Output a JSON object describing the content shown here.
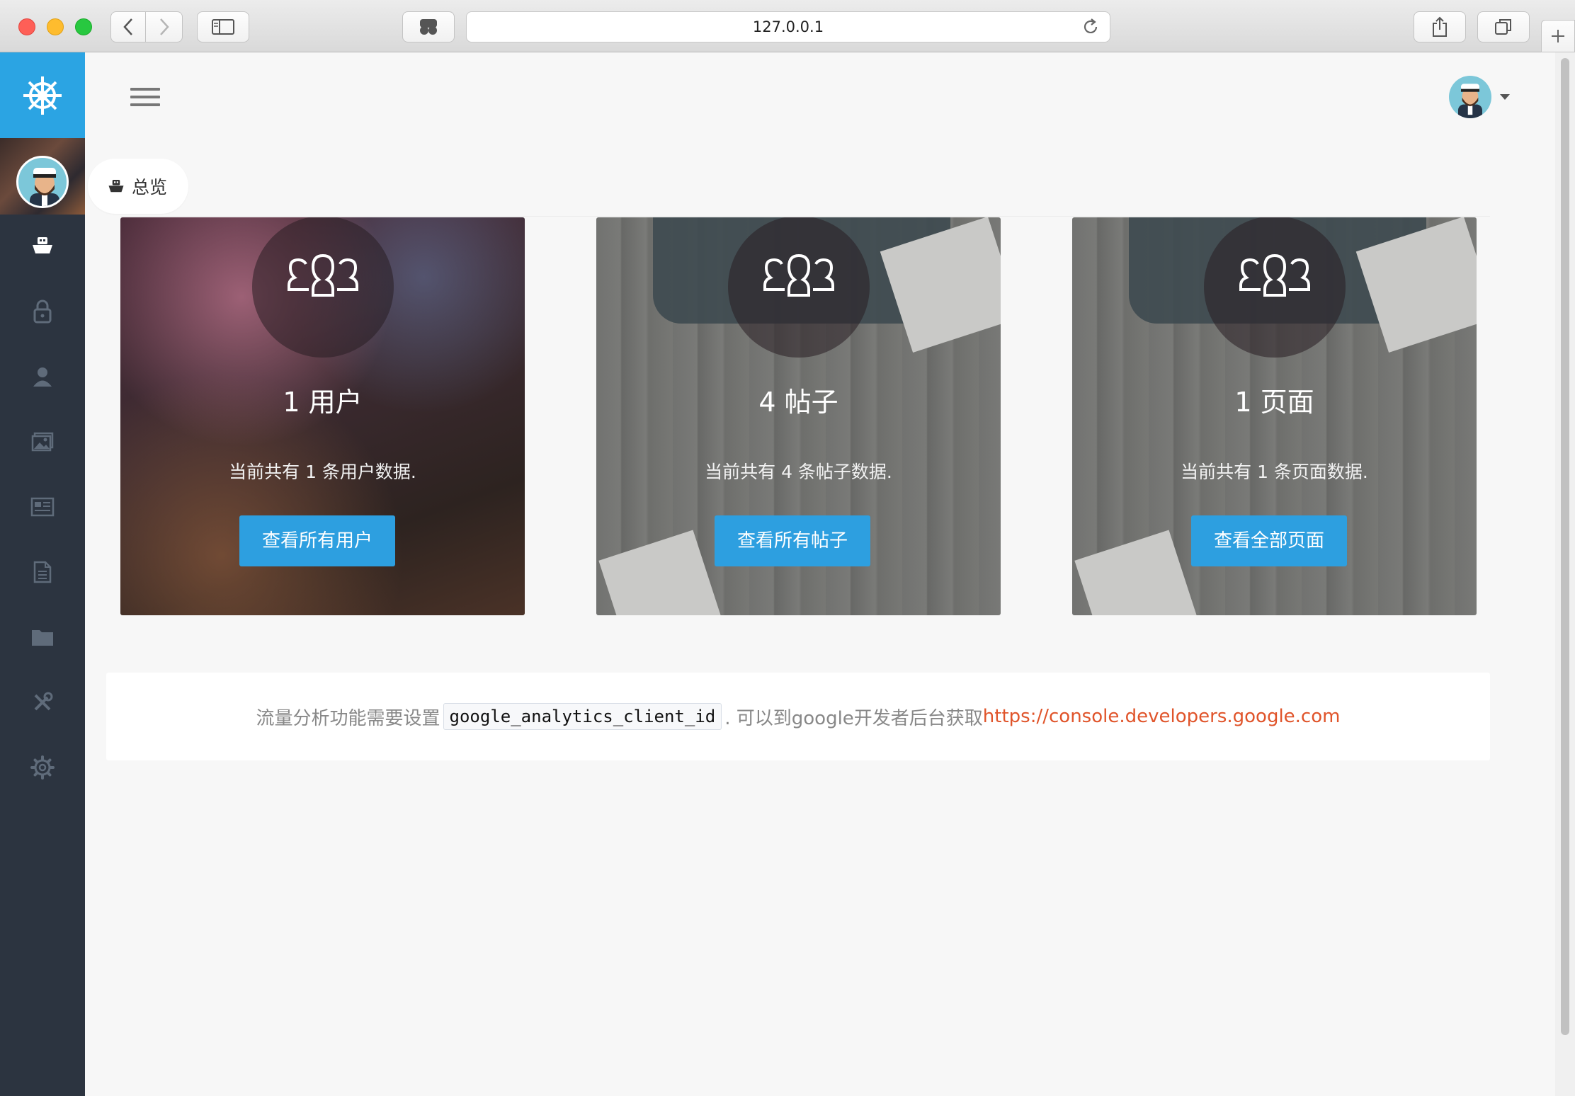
{
  "browser": {
    "url": "127.0.0.1"
  },
  "sidebar": {
    "items": [
      {
        "icon": "ship-icon"
      },
      {
        "icon": "lock-icon"
      },
      {
        "icon": "user-icon"
      },
      {
        "icon": "image-icon"
      },
      {
        "icon": "newspaper-icon"
      },
      {
        "icon": "document-icon"
      },
      {
        "icon": "folder-icon"
      },
      {
        "icon": "tools-icon"
      },
      {
        "icon": "gear-icon"
      }
    ]
  },
  "breadcrumb": {
    "label": "总览"
  },
  "cards": [
    {
      "title": "1 用户",
      "desc": "当前共有 1 条用户数据.",
      "button": "查看所有用户"
    },
    {
      "title": "4 帖子",
      "desc": "当前共有 4 条帖子数据.",
      "button": "查看所有帖子"
    },
    {
      "title": "1 页面",
      "desc": "当前共有 1 条页面数据.",
      "button": "查看全部页面"
    }
  ],
  "notice": {
    "prefix": "流量分析功能需要设置",
    "code": "google_analytics_client_id",
    "middle": ". 可以到google开发者后台获取",
    "link": "https://console.developers.google.com"
  },
  "colors": {
    "accent": "#2ba4e3",
    "sidebar_bg": "#2c3440",
    "button": "#2d9fe0",
    "link": "#e0542a"
  }
}
